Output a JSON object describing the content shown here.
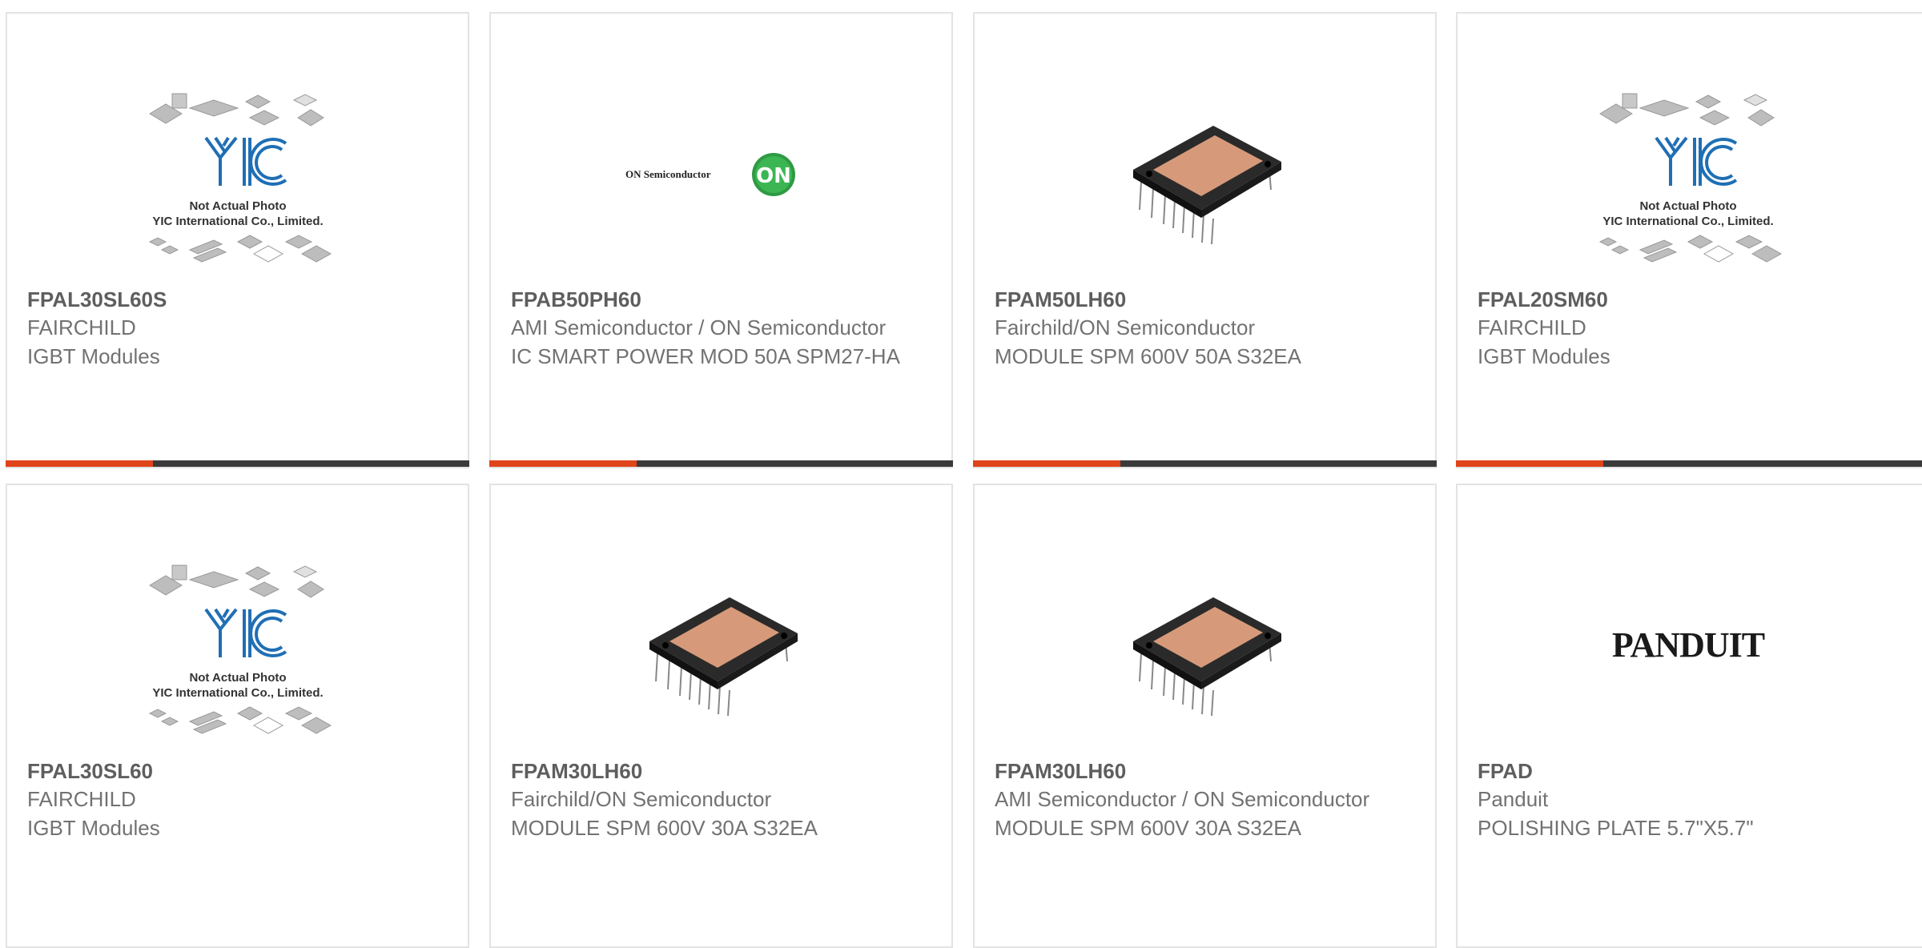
{
  "colors": {
    "accent": "#e0441b",
    "bar": "#3a3a3a",
    "border": "#e3e3e3",
    "text": "#727272"
  },
  "products": [
    {
      "part": "FPAL30SL60S",
      "manufacturer": "FAIRCHILD",
      "description": "IGBT Modules",
      "image": "placeholder-yic-icon",
      "caption_line1": "Not Actual Photo",
      "caption_line2": "YIC International Co., Limited."
    },
    {
      "part": "FPAB50PH60",
      "manufacturer": "AMI Semiconductor / ON Semiconductor",
      "description": "IC SMART POWER MOD 50A SPM27-HA",
      "image": "on-semiconductor-logo",
      "logo_text": "ON Semiconductor",
      "badge_text": "ON"
    },
    {
      "part": "FPAM50LH60",
      "manufacturer": "Fairchild/ON Semiconductor",
      "description": "MODULE SPM 600V 50A S32EA",
      "image": "spm-module-photo"
    },
    {
      "part": "FPAL20SM60",
      "manufacturer": "FAIRCHILD",
      "description": "IGBT Modules",
      "image": "placeholder-yic-icon",
      "caption_line1": "Not Actual Photo",
      "caption_line2": "YIC International Co., Limited."
    },
    {
      "part": "FPAL30SL60",
      "manufacturer": "FAIRCHILD",
      "description": "IGBT Modules",
      "image": "placeholder-yic-icon",
      "caption_line1": "Not Actual Photo",
      "caption_line2": "YIC International Co., Limited."
    },
    {
      "part": "FPAM30LH60",
      "manufacturer": "Fairchild/ON Semiconductor",
      "description": "MODULE SPM 600V 30A S32EA",
      "image": "spm-module-photo"
    },
    {
      "part": "FPAM30LH60",
      "manufacturer": "AMI Semiconductor / ON Semiconductor",
      "description": "MODULE SPM 600V 30A S32EA",
      "image": "spm-module-photo"
    },
    {
      "part": "FPAD",
      "manufacturer": "Panduit",
      "description": "POLISHING PLATE 5.7\"X5.7\"",
      "image": "panduit-logo",
      "logo_text": "PANDUIT"
    }
  ]
}
